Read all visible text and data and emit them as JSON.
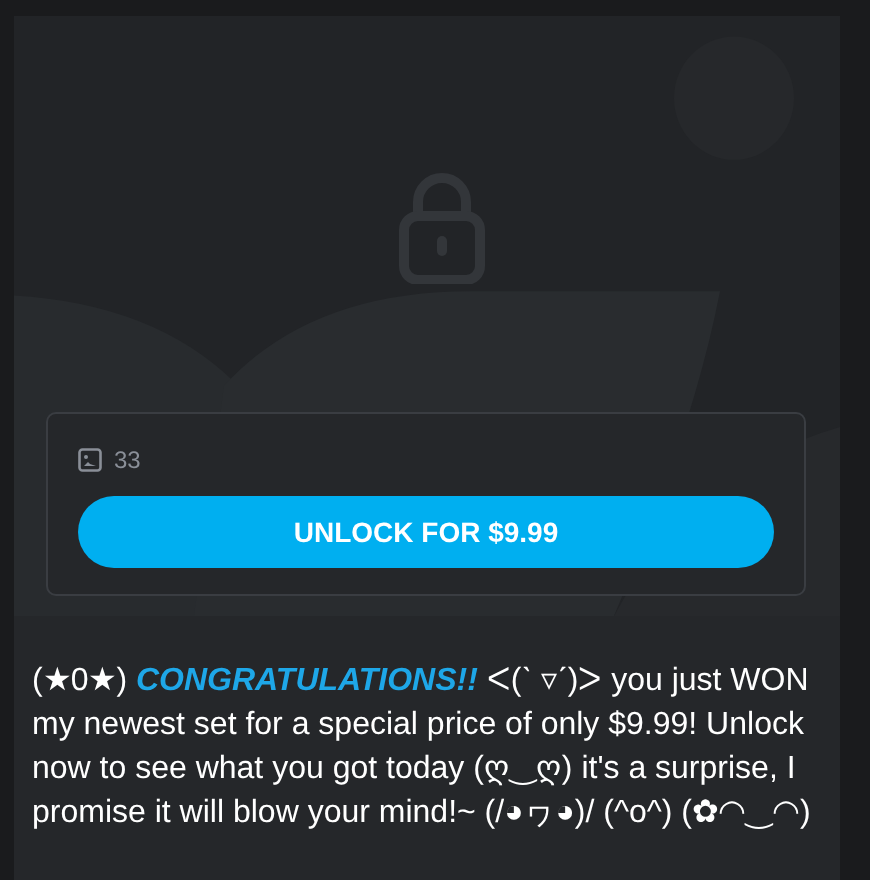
{
  "media": {
    "kind": "picture",
    "count": "33",
    "button": "UNLOCK FOR $9.99"
  },
  "caption": "(★0★) *CONGRATULATIONS!!* ᐸ(ˋ ▿ˊ)ᐳ you just WON my newest set for a special price of only $9.99! Unlock now to see what you got today (ღ‿ღ) it's a surprise, I promise it will blow your mind!~ (/◕ヮ◕)/ (^o^) (✿◠‿◠)"
}
